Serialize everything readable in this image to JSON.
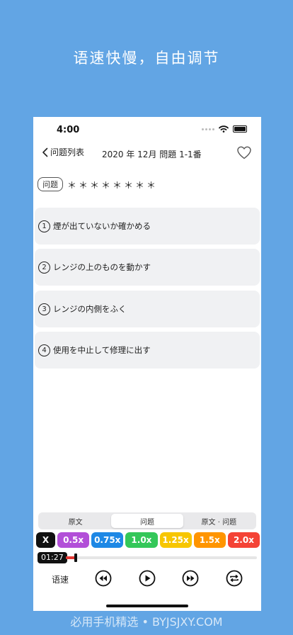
{
  "promo": {
    "title": "语速快慢，自由调节"
  },
  "status": {
    "time": "4:00"
  },
  "nav": {
    "back_label": "问题列表",
    "title": "2020 年 12月 問題 1-1番"
  },
  "question": {
    "tag": "问题",
    "masked_text": "＊＊＊＊＊＊＊＊"
  },
  "options": [
    {
      "num": "1",
      "text": "煙が出ていないか確かめる"
    },
    {
      "num": "2",
      "text": "レンジの上のものを動かす"
    },
    {
      "num": "3",
      "text": "レンジの内側をふく"
    },
    {
      "num": "4",
      "text": "使用を中止して修理に出す"
    }
  ],
  "segments": [
    {
      "label": "原文",
      "active": false
    },
    {
      "label": "问题",
      "active": true
    },
    {
      "label": "原文 · 问题",
      "active": false
    }
  ],
  "speeds": [
    {
      "label": "X",
      "color": "#111111"
    },
    {
      "label": "0.5x",
      "color": "#b24fd8"
    },
    {
      "label": "0.75x",
      "color": "#1e88e5"
    },
    {
      "label": "1.0x",
      "color": "#34c759"
    },
    {
      "label": "1.25x",
      "color": "#f7c600"
    },
    {
      "label": "1.5x",
      "color": "#ff9500"
    },
    {
      "label": "2.0x",
      "color": "#f44336"
    }
  ],
  "player": {
    "current_time": "01:27",
    "progress": 0.05,
    "speed_label": "语速"
  },
  "watermark": {
    "text": "必用手机精选 • BYJSJXY.COM"
  },
  "colors": {
    "background": "#62a5e4",
    "card": "#f0f1f3",
    "progress": "#e53935"
  }
}
